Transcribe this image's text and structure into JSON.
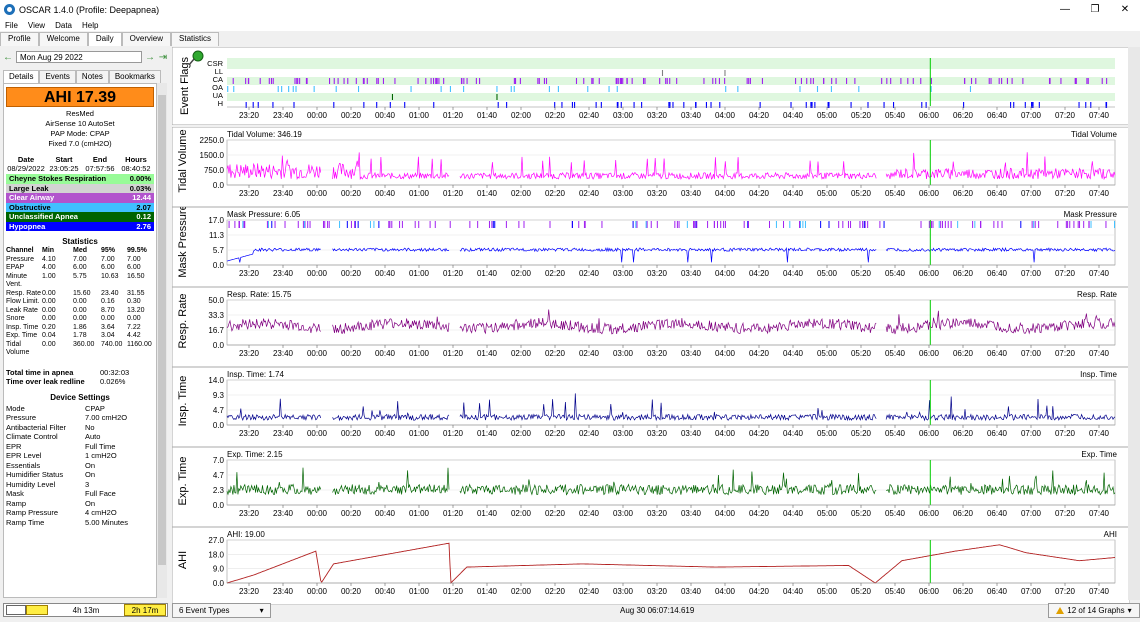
{
  "window": {
    "title": "OSCAR 1.4.0 (Profile: Deepapnea)",
    "min": "—",
    "restore": "❐",
    "close": "✕"
  },
  "menu": [
    "File",
    "View",
    "Data",
    "Help"
  ],
  "tabs": [
    "Profile",
    "Welcome",
    "Daily",
    "Overview",
    "Statistics"
  ],
  "nav": {
    "date": "Mon Aug 29 2022",
    "prev": "←",
    "next": "→",
    "last": "⇥"
  },
  "subtabs": [
    "Details",
    "Events",
    "Notes",
    "Bookmarks"
  ],
  "summary": {
    "ahi": "AHI 17.39",
    "vendor": "ResMed",
    "model": "AirSense 10 AutoSet",
    "mode": "PAP Mode: CPAP",
    "fixed": "Fixed 7.0 (cmH2O)",
    "sess_headers": [
      "Date",
      "Start",
      "End",
      "Hours"
    ],
    "sess_values": [
      "08/29/2022",
      "23:05:25",
      "07:57:56",
      "08:40:52"
    ],
    "indices": [
      {
        "name": "Cheyne Stokes Respiration",
        "value": "0.00%",
        "bg": "#98fb98",
        "fg": "#000000"
      },
      {
        "name": "Large Leak",
        "value": "0.03%",
        "bg": "#d3d3d3",
        "fg": "#000000"
      },
      {
        "name": "Clear Airway",
        "value": "12.44",
        "bg": "#b254cd",
        "fg": "#ffffff"
      },
      {
        "name": "Obstructive",
        "value": "2.07",
        "bg": "#40c0ff",
        "fg": "#000000"
      },
      {
        "name": "Unclassified Apnea",
        "value": "0.12",
        "bg": "#006400",
        "fg": "#ffffff"
      },
      {
        "name": "Hypopnea",
        "value": "2.76",
        "bg": "#0000ff",
        "fg": "#ffffff"
      }
    ]
  },
  "statistics": {
    "title": "Statistics",
    "headers": [
      "Channel",
      "Min",
      "Med",
      "95%",
      "99.5%"
    ],
    "rows": [
      [
        "Pressure",
        "4.10",
        "7.00",
        "7.00",
        "7.00"
      ],
      [
        "EPAP",
        "4.00",
        "6.00",
        "6.00",
        "6.00"
      ],
      [
        "Minute Vent.",
        "1.00",
        "5.75",
        "10.63",
        "16.50"
      ],
      [
        "Resp. Rate",
        "0.00",
        "15.60",
        "23.40",
        "31.55"
      ],
      [
        "Flow Limit.",
        "0.00",
        "0.00",
        "0.16",
        "0.30"
      ],
      [
        "Leak Rate",
        "0.00",
        "0.00",
        "8.70",
        "13.20"
      ],
      [
        "Snore",
        "0.00",
        "0.00",
        "0.00",
        "0.00"
      ],
      [
        "Insp. Time",
        "0.20",
        "1.86",
        "3.64",
        "7.22"
      ],
      [
        "Exp. Time",
        "0.04",
        "1.78",
        "3.04",
        "4.42"
      ],
      [
        "Tidal Volume",
        "0.00",
        "360.00",
        "740.00",
        "1160.00"
      ]
    ]
  },
  "totals": [
    {
      "label": "Total time in apnea",
      "value": "00:32:03"
    },
    {
      "label": "Time over leak redline",
      "value": "0.026%"
    }
  ],
  "device": {
    "title": "Device Settings",
    "rows": [
      [
        "Mode",
        "CPAP"
      ],
      [
        "Pressure",
        "7.00 cmH2O"
      ],
      [
        "Antibacterial Filter",
        "No"
      ],
      [
        "Climate Control",
        "Auto"
      ],
      [
        "EPR",
        "Full Time"
      ],
      [
        "EPR Level",
        "1 cmH2O"
      ],
      [
        "Essentials",
        "On"
      ],
      [
        "Humidifier Status",
        "On"
      ],
      [
        "Humidity Level",
        "3"
      ],
      [
        "Mask",
        "Full Face"
      ],
      [
        "Ramp",
        "On"
      ],
      [
        "Ramp Pressure",
        "4 cmH2O"
      ],
      [
        "Ramp Time",
        "5.00 Minutes"
      ]
    ]
  },
  "bottom_left": {
    "left": "4h 13m",
    "right": "2h 17m"
  },
  "time_ticks": [
    "23:20",
    "23:40",
    "00:00",
    "00:20",
    "00:40",
    "01:00",
    "01:20",
    "01:40",
    "02:00",
    "02:20",
    "02:40",
    "03:00",
    "03:20",
    "03:40",
    "04:00",
    "04:20",
    "04:40",
    "05:00",
    "05:20",
    "05:40",
    "06:00",
    "06:20",
    "06:40",
    "07:00",
    "07:20",
    "07:40"
  ],
  "cursor_fraction": 0.792,
  "event_flags": {
    "title": "Event Flags",
    "rows": [
      "CSR",
      "LL",
      "CA",
      "OA",
      "UA",
      "H"
    ],
    "colors": [
      "#98fb98",
      "#808080",
      "#a020f0",
      "#40c0ff",
      "#006400",
      "#0000ff"
    ]
  },
  "graphs": [
    {
      "title": "Tidal Volume",
      "label": "Tidal Volume: 346.19",
      "legend": "Tidal Volume",
      "ticks": [
        "2250.0",
        "1500.0",
        "750.0",
        "0.0"
      ],
      "ymax": 2250,
      "color": "#ff00ff"
    },
    {
      "title": "Mask Pressure",
      "label": "Mask Pressure: 6.05",
      "legend": "Mask Pressure",
      "ticks": [
        "17.0",
        "11.3",
        "5.7",
        "0.0"
      ],
      "ymax": 17,
      "color": "#0000ff"
    },
    {
      "title": "Resp. Rate",
      "label": "Resp. Rate: 15.75",
      "legend": "Resp. Rate",
      "ticks": [
        "50.0",
        "33.3",
        "16.7",
        "0.0"
      ],
      "ymax": 50,
      "color": "#800080"
    },
    {
      "title": "Insp. Time",
      "label": "Insp. Time: 1.74",
      "legend": "Insp. Time",
      "ticks": [
        "14.0",
        "9.3",
        "4.7",
        "0.0"
      ],
      "ymax": 14,
      "color": "#00008b"
    },
    {
      "title": "Exp. Time",
      "label": "Exp. Time: 2.15",
      "legend": "Exp. Time",
      "ticks": [
        "7.0",
        "4.7",
        "2.3",
        "0.0"
      ],
      "ymax": 7,
      "color": "#006400"
    },
    {
      "title": "AHI",
      "label": "AHI: 19.00",
      "legend": "AHI",
      "ticks": [
        "27.0",
        "18.0",
        "9.0",
        "0.0"
      ],
      "ymax": 27,
      "color": "#b22222"
    }
  ],
  "status": {
    "event_types": "6 Event Types",
    "datetime": "Aug 30 06:07:14.619",
    "graphs": "12 of 14 Graphs"
  }
}
